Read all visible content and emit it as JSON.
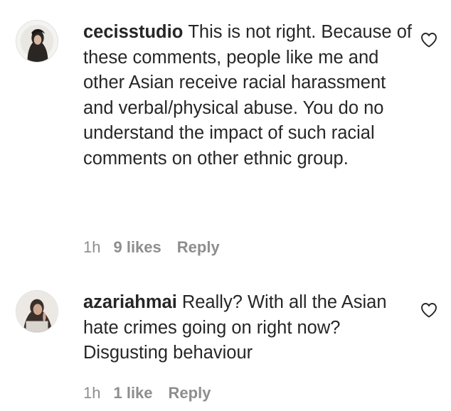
{
  "comments": [
    {
      "username": "cecisstudio",
      "text": "This is not right. Because of these comments, people like me and other Asian receive racial harassment and verbal/physical abuse. You do no understand the impact of such racial comments on other ethnic group.",
      "time": "1h",
      "likes": "9 likes",
      "reply_label": "Reply",
      "icon": "heart-outline-icon"
    },
    {
      "username": "azariahmai",
      "text": "Really? With all the Asian hate crimes going on right now? Disgusting behaviour",
      "time": "1h",
      "likes": "1 like",
      "reply_label": "Reply",
      "icon": "heart-outline-icon"
    }
  ]
}
